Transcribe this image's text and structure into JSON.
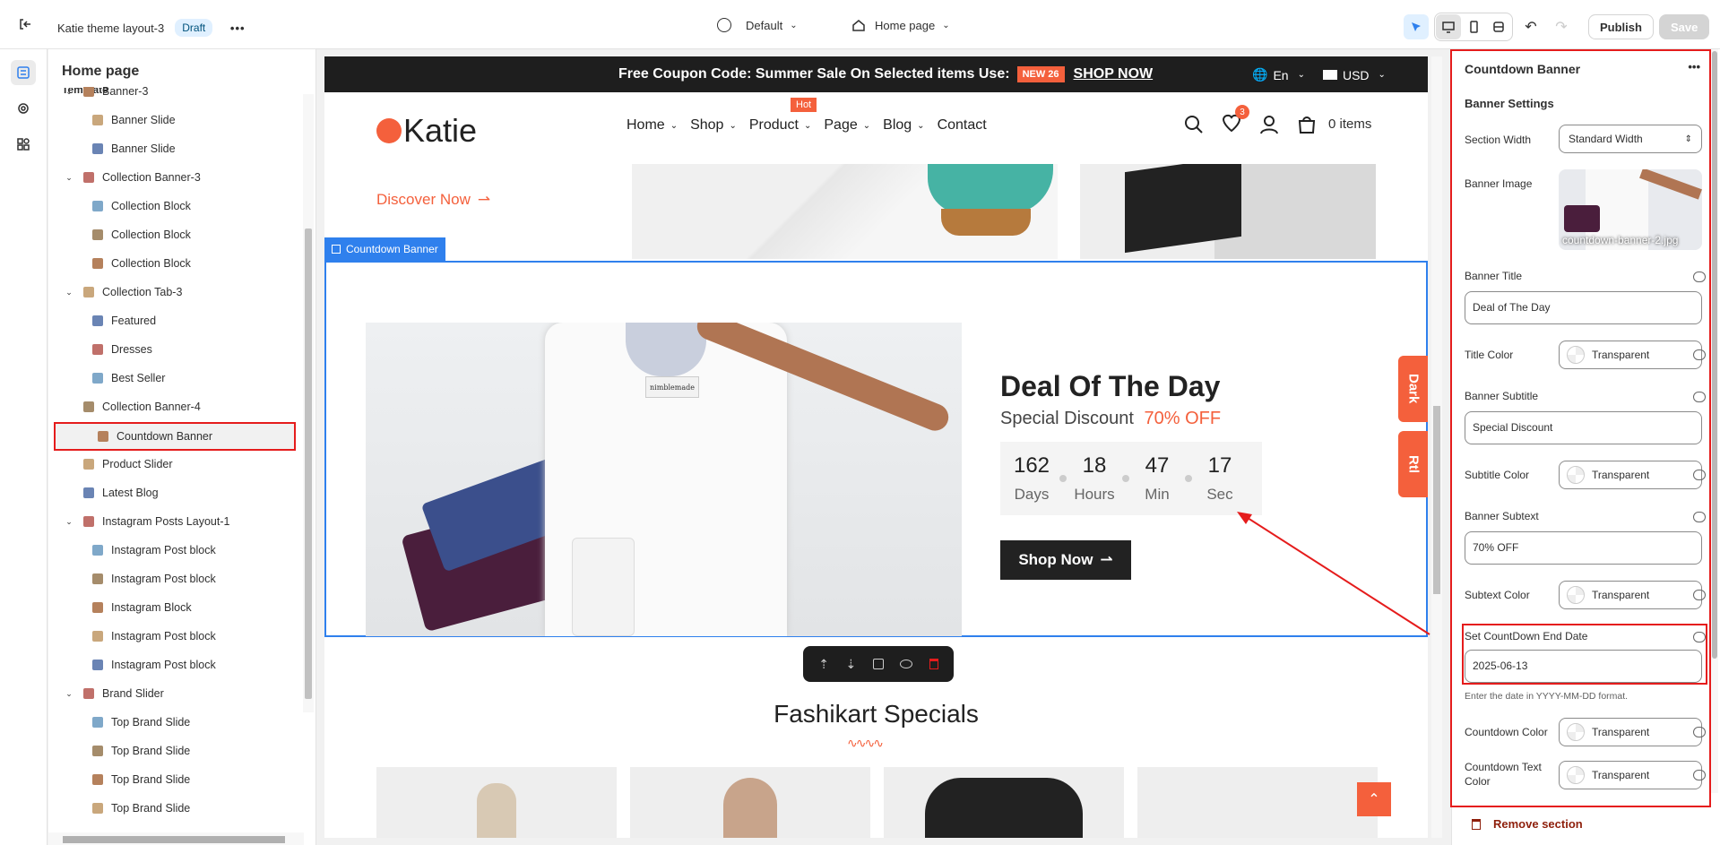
{
  "topbar": {
    "theme_name": "Katie theme layout-3",
    "status": "Draft",
    "theme_switch": "Default",
    "page_switch": "Home page",
    "publish": "Publish",
    "save": "Save"
  },
  "left": {
    "title": "Home page",
    "group_label": "Template",
    "items": [
      {
        "label": "Banner-3",
        "level": 0
      },
      {
        "label": "Banner Slide",
        "level": 1
      },
      {
        "label": "Banner Slide",
        "level": 1
      },
      {
        "label": "Collection Banner-3",
        "level": 0
      },
      {
        "label": "Collection Block",
        "level": 1
      },
      {
        "label": "Collection Block",
        "level": 1
      },
      {
        "label": "Collection Block",
        "level": 1
      },
      {
        "label": "Collection Tab-3",
        "level": 0
      },
      {
        "label": "Featured",
        "level": 1
      },
      {
        "label": "Dresses",
        "level": 1
      },
      {
        "label": "Best Seller",
        "level": 1
      },
      {
        "label": "Collection Banner-4",
        "level": 0
      },
      {
        "label": "Countdown Banner",
        "level": 0
      },
      {
        "label": "Product Slider",
        "level": 0
      },
      {
        "label": "Latest Blog",
        "level": 0
      },
      {
        "label": "Instagram Posts Layout-1",
        "level": 0
      },
      {
        "label": "Instagram Post block",
        "level": 1
      },
      {
        "label": "Instagram Post block",
        "level": 1
      },
      {
        "label": "Instagram Block",
        "level": 1
      },
      {
        "label": "Instagram Post block",
        "level": 1
      },
      {
        "label": "Instagram Post block",
        "level": 1
      },
      {
        "label": "Brand Slider",
        "level": 0
      },
      {
        "label": "Top Brand Slide",
        "level": 1
      },
      {
        "label": "Top Brand Slide",
        "level": 1
      },
      {
        "label": "Top Brand Slide",
        "level": 1
      },
      {
        "label": "Top Brand Slide",
        "level": 1
      }
    ]
  },
  "store": {
    "announcement": "Free Coupon Code: Summer Sale On Selected items Use:",
    "coupon": "NEW 26",
    "shop_now": "SHOP NOW",
    "lang": "En",
    "currency": "USD",
    "logo": "Katie",
    "nav": [
      "Home",
      "Shop",
      "Product",
      "Page",
      "Blog",
      "Contact"
    ],
    "hot": "Hot",
    "wish_count": "3",
    "cart": "0 items",
    "discover": "Discover Now",
    "section_tag": "Countdown Banner",
    "deal_title": "Deal Of The Day",
    "subtitle": "Special Discount",
    "subtext": "70% OFF",
    "countdown": [
      {
        "value": "162",
        "unit": "Days"
      },
      {
        "value": "18",
        "unit": "Hours"
      },
      {
        "value": "47",
        "unit": "Min"
      },
      {
        "value": "17",
        "unit": "Sec"
      }
    ],
    "shop_btn": "Shop Now",
    "dark": "Dark",
    "rtl": "Rtl",
    "specials": "Fashikart Specials",
    "shirt_label": "nimblemade"
  },
  "right": {
    "panel_title": "Countdown Banner",
    "settings_title": "Banner Settings",
    "section_width_label": "Section Width",
    "section_width_value": "Standard Width",
    "banner_image_label": "Banner Image",
    "banner_image_name": "countdown-banner-2.jpg",
    "banner_title_label": "Banner Title",
    "banner_title_value": "Deal of The Day",
    "title_color_label": "Title Color",
    "banner_subtitle_label": "Banner Subtitle",
    "banner_subtitle_value": "Special Discount",
    "subtitle_color_label": "Subtitle Color",
    "banner_subtext_label": "Banner Subtext",
    "banner_subtext_value": "70% OFF",
    "subtext_color_label": "Subtext Color",
    "end_date_label": "Set CountDown End Date",
    "end_date_value": "2025-06-13",
    "end_date_help": "Enter the date in YYYY-MM-DD format.",
    "countdown_color_label": "Countdown Color",
    "countdown_text_color_label": "Countdown Text Color",
    "transparent": "Transparent",
    "remove": "Remove section"
  },
  "colors": {
    "accent": "#f4603c",
    "selection": "#2f80ed",
    "highlight": "#e51c1c"
  }
}
